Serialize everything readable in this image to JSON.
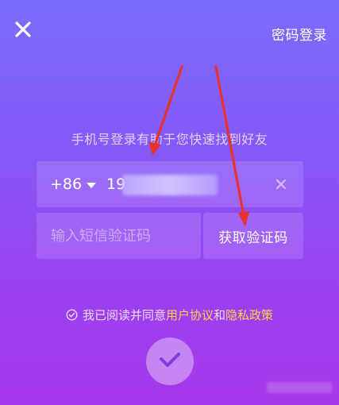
{
  "header": {
    "close_icon": "close-icon",
    "password_login_label": "密码登录"
  },
  "subtitle": "手机号登录有助于您快速找到好友",
  "phone": {
    "country_code": "+86",
    "value": "19",
    "clear_icon": "clear-icon"
  },
  "sms": {
    "placeholder": "输入短信验证码",
    "get_code_label": "获取验证码"
  },
  "agreement": {
    "prefix": "我已阅读并同意",
    "user_agreement": "用户协议",
    "and": "和",
    "privacy_policy": "隐私政策"
  },
  "colors": {
    "link": "#ffd24d",
    "arrow": "#e8322f",
    "bg_top": "#7a6dfb",
    "bg_bottom": "#a637ea"
  }
}
